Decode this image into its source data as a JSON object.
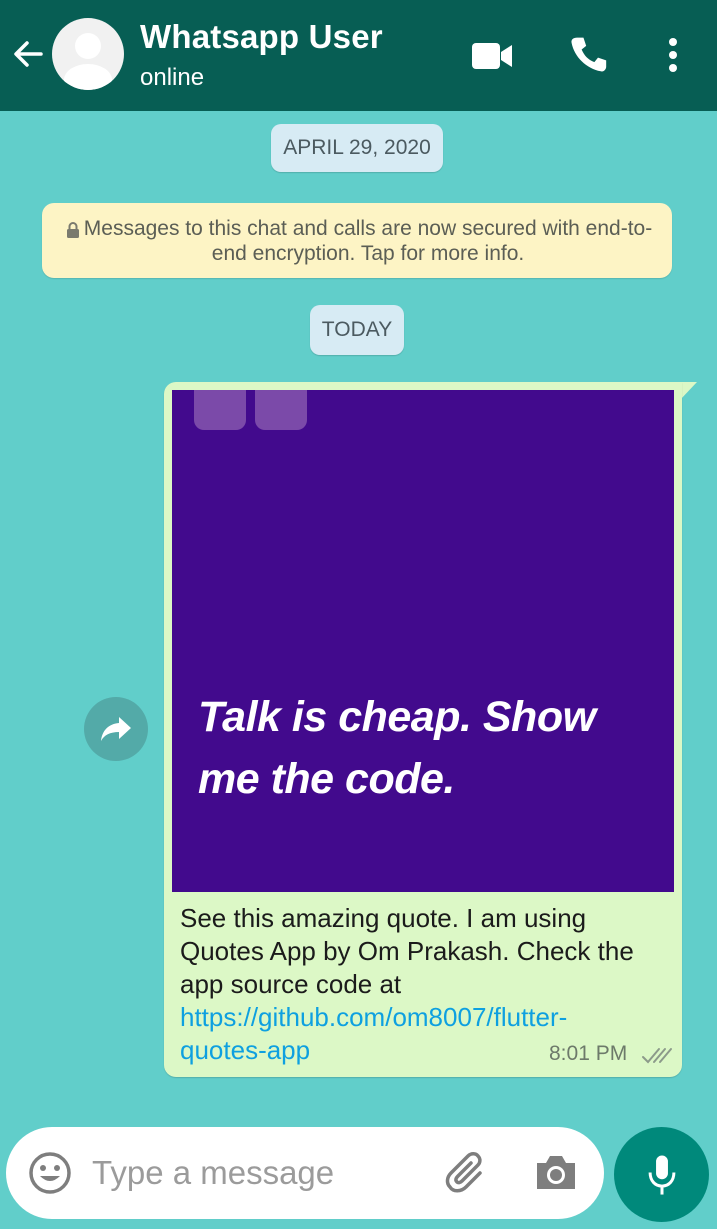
{
  "header": {
    "title": "Whatsapp User",
    "status": "online"
  },
  "chat": {
    "date_chip": "APRIL 29, 2020",
    "encryption_notice": "Messages to this chat and calls are now secured with end-to-end encryption. Tap for more info.",
    "today_chip": "TODAY"
  },
  "message": {
    "image_quote": "Talk is cheap. Show me the code.",
    "text": "See this amazing quote. I am using Quotes App by Om Prakash. Check the app source code at ",
    "link": "https://github.com/om8007/flutter-quotes-app",
    "time": "8:01 PM",
    "quote_bg_color": "#420a8d",
    "bubble_color": "#dcf8c6"
  },
  "input": {
    "placeholder": "Type a message"
  },
  "colors": {
    "header": "#075e54",
    "chat_bg": "#61ceca",
    "accent": "#00897b",
    "link": "#0ea0e0"
  },
  "icons": [
    "back-arrow-icon",
    "avatar-placeholder-icon",
    "video-call-icon",
    "phone-icon",
    "more-vert-icon",
    "lock-icon",
    "forward-icon",
    "double-check-icon",
    "emoji-icon",
    "attach-icon",
    "camera-icon",
    "mic-icon"
  ]
}
